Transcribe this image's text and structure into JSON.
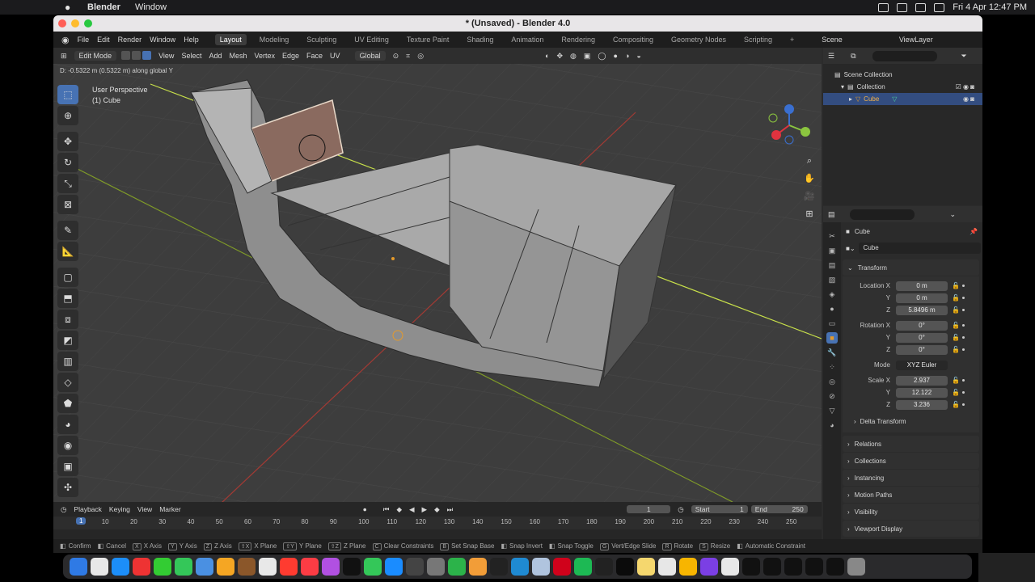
{
  "mac": {
    "app": "Blender",
    "menu": "Window",
    "datetime": "Fri 4 Apr  12:47 PM"
  },
  "window": {
    "title": "* (Unsaved) - Blender 4.0"
  },
  "menubar": {
    "items": [
      "File",
      "Edit",
      "Render",
      "Window",
      "Help"
    ],
    "workspaces": [
      "Layout",
      "Modeling",
      "Sculpting",
      "UV Editing",
      "Texture Paint",
      "Shading",
      "Animation",
      "Rendering",
      "Compositing",
      "Geometry Nodes",
      "Scripting",
      "+"
    ],
    "active_workspace": "Layout",
    "scene": "Scene",
    "viewlayer": "ViewLayer"
  },
  "header": {
    "mode": "Edit Mode",
    "menus": [
      "View",
      "Select",
      "Add",
      "Mesh",
      "Vertex",
      "Edge",
      "Face",
      "UV"
    ],
    "orientation": "Global"
  },
  "viewport": {
    "status": "D: -0.5322 m (0.5322 m) along global Y",
    "perspective": "User Perspective",
    "object_label": "(1) Cube"
  },
  "outliner": {
    "rows": [
      {
        "label": "Scene Collection"
      },
      {
        "label": "Collection"
      },
      {
        "label": "Cube"
      }
    ]
  },
  "properties": {
    "object_name": "Cube",
    "datablock": "Cube",
    "transform_label": "Transform",
    "location": {
      "label": "Location X",
      "x": "0 m",
      "y": "0 m",
      "z": "5.8496 m"
    },
    "rotation": {
      "label": "Rotation X",
      "x": "0°",
      "y": "0°",
      "z": "0°"
    },
    "mode": {
      "label": "Mode",
      "value": "XYZ Euler"
    },
    "scale": {
      "label": "Scale X",
      "x": "2.937",
      "y": "12.122",
      "z": "3.236"
    },
    "axis_y": "Y",
    "axis_z": "Z",
    "delta": "Delta Transform",
    "panels": [
      "Relations",
      "Collections",
      "Instancing",
      "Motion Paths",
      "Visibility",
      "Viewport Display"
    ]
  },
  "timeline": {
    "menus": [
      "Playback",
      "Keying",
      "View",
      "Marker"
    ],
    "current_frame": "1",
    "start_label": "Start",
    "start": "1",
    "end_label": "End",
    "end": "250",
    "ticks": [
      "1",
      "10",
      "20",
      "30",
      "40",
      "50",
      "60",
      "70",
      "80",
      "90",
      "100",
      "110",
      "120",
      "130",
      "140",
      "150",
      "160",
      "170",
      "180",
      "190",
      "200",
      "210",
      "220",
      "230",
      "240",
      "250"
    ]
  },
  "statusbar": {
    "items": [
      {
        "key": "",
        "label": "Confirm"
      },
      {
        "key": "",
        "label": "Cancel"
      },
      {
        "key": "X",
        "label": "X Axis"
      },
      {
        "key": "Y",
        "label": "Y Axis"
      },
      {
        "key": "Z",
        "label": "Z Axis"
      },
      {
        "key": "⇧X",
        "label": "X Plane"
      },
      {
        "key": "⇧Y",
        "label": "Y Plane"
      },
      {
        "key": "⇧Z",
        "label": "Z Plane"
      },
      {
        "key": "C",
        "label": "Clear Constraints"
      },
      {
        "key": "B",
        "label": "Set Snap Base"
      },
      {
        "key": "",
        "label": "Snap Invert"
      },
      {
        "key": "",
        "label": "Snap Toggle"
      },
      {
        "key": "G",
        "label": "Vert/Edge Slide"
      },
      {
        "key": "R",
        "label": "Rotate"
      },
      {
        "key": "S",
        "label": "Resize"
      },
      {
        "key": "",
        "label": "Automatic Constraint"
      }
    ]
  },
  "colors": {
    "accent": "#4772b3",
    "selection": "#334d80",
    "axis_x": "#c0392b",
    "axis_y": "#9acd32",
    "viewport_bg": "#3d3d3d",
    "mesh_face": "#9a9a9a",
    "selected_face": "#8a6a5f"
  },
  "icons": [
    "apple-logo-icon",
    "blender-logo-icon",
    "select-box-icon",
    "cursor-icon",
    "move-icon",
    "rotate-icon",
    "scale-icon",
    "transform-icon",
    "annotate-icon",
    "measure-icon",
    "add-cube-icon",
    "extrude-icon",
    "inset-icon",
    "bevel-icon",
    "loop-cut-icon",
    "knife-icon",
    "poly-build-icon",
    "spin-icon",
    "smooth-icon",
    "shrink-icon",
    "shear-icon",
    "zoom-icon",
    "hand-icon",
    "camera-icon",
    "grid-icon"
  ]
}
